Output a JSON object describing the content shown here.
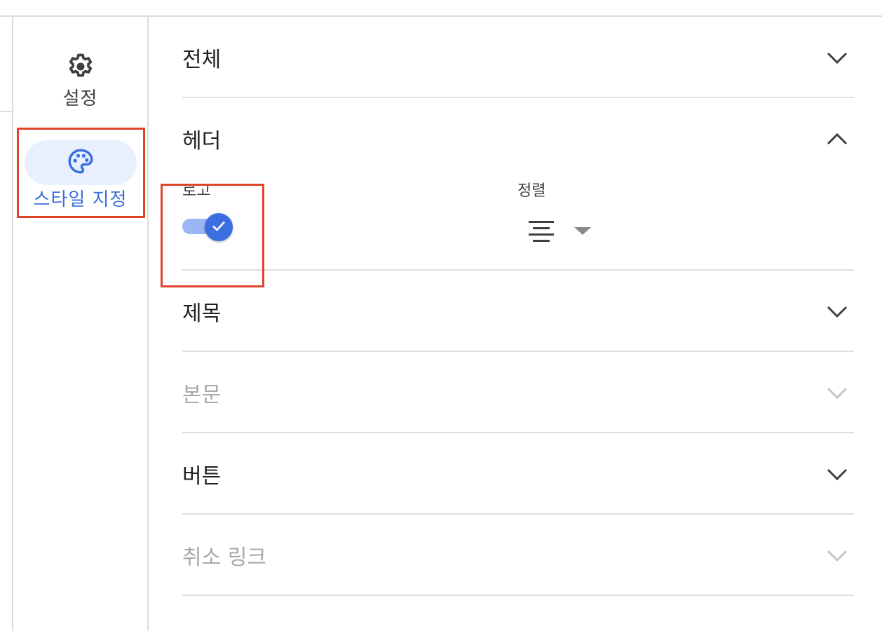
{
  "rail": {
    "settings": {
      "label": "설정",
      "icon": "gear-icon"
    },
    "style": {
      "label": "스타일 지정",
      "icon": "palette-icon"
    }
  },
  "sections": [
    {
      "title": "전체",
      "state": "collapsed",
      "enabled": true
    },
    {
      "title": "헤더",
      "state": "expanded",
      "enabled": true
    },
    {
      "title": "제목",
      "state": "collapsed",
      "enabled": true
    },
    {
      "title": "본문",
      "state": "collapsed",
      "enabled": false
    },
    {
      "title": "버튼",
      "state": "collapsed",
      "enabled": true
    },
    {
      "title": "취소 링크",
      "state": "collapsed",
      "enabled": false
    }
  ],
  "header": {
    "logo_label": "로고",
    "logo_enabled": true,
    "align_label": "정렬",
    "align_value_icon": "align-center-icon"
  },
  "colors": {
    "accent": "#3b6fe0",
    "highlight_border": "#e0452a",
    "rail_selected_bg": "#e8f0fe"
  }
}
